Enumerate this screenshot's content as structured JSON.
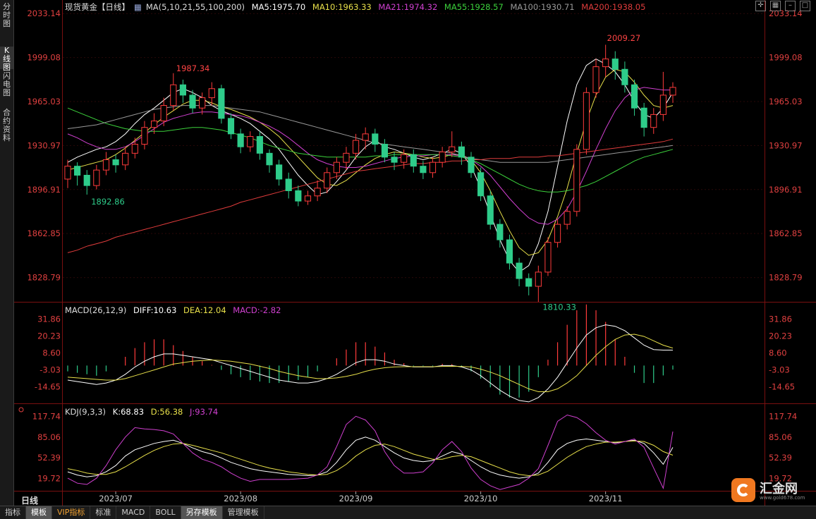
{
  "sidebar": {
    "items": [
      {
        "label": "分时图",
        "active": false
      },
      {
        "label": "K线图",
        "active": true
      },
      {
        "label": "闪电图",
        "active": false
      },
      {
        "label": "合约资料",
        "active": false
      }
    ]
  },
  "main_legend": {
    "title": "现货黄金【日线】",
    "ma_params": "MA(5,10,21,55,100,200)",
    "ma5": "MA5:1975.70",
    "ma10": "MA10:1963.33",
    "ma21": "MA21:1974.32",
    "ma55": "MA55:1928.57",
    "ma100": "MA100:1930.71",
    "ma200": "MA200:1938.05"
  },
  "macd_legend": {
    "params": "MACD(26,12,9)",
    "diff": "DIFF:10.63",
    "dea": "DEA:12.04",
    "macd": "MACD:-2.82"
  },
  "kdj_legend": {
    "params": "KDJ(9,3,3)",
    "k": "K:68.83",
    "d": "D:56.38",
    "j": "J:93.74"
  },
  "price_axis": [
    "2033.14",
    "1999.08",
    "1965.03",
    "1930.97",
    "1896.91",
    "1862.85",
    "1828.79"
  ],
  "macd_axis": [
    "31.86",
    "20.23",
    "8.60",
    "-3.03",
    "-14.65"
  ],
  "kdj_axis": [
    "117.74",
    "85.06",
    "52.39",
    "19.72"
  ],
  "date_axis": [
    "2023/07",
    "2023/08",
    "2023/09",
    "2023/10",
    "2023/11"
  ],
  "annotations": {
    "high1": "1987.34",
    "low1": "1892.86",
    "low2": "1810.33",
    "high2": "2009.27"
  },
  "period_label": "日线",
  "bottom_tabs": [
    {
      "label": "指标",
      "active": false
    },
    {
      "label": "模板",
      "active": true
    },
    {
      "label": "VIP指标",
      "active": false,
      "vip": true
    },
    {
      "label": "标准",
      "active": false
    },
    {
      "label": "MACD",
      "active": false
    },
    {
      "label": "BOLL",
      "active": false
    },
    {
      "label": "另存模板",
      "active": true
    },
    {
      "label": "管理模板",
      "active": false
    }
  ],
  "logo": {
    "text": "汇金网",
    "url": "www.gold678.com"
  },
  "colors": {
    "up": "#ff3b3b",
    "down": "#2ecc8a",
    "ma5": "#ffffff",
    "ma10": "#e8e04a",
    "ma21": "#d040d0",
    "ma55": "#3cd23c",
    "ma100": "#999999",
    "ma200": "#e03c3c",
    "axis_text": "#e04040"
  },
  "chart_data": {
    "type": "candlestick",
    "ylim": [
      1810,
      2036
    ],
    "ma": {
      "ma5": [
        1918,
        1922,
        1925,
        1928,
        1930,
        1934,
        1940,
        1948,
        1955,
        1960,
        1966,
        1972,
        1975,
        1972,
        1968,
        1962,
        1958,
        1955,
        1952,
        1948,
        1942,
        1936,
        1928,
        1918,
        1908,
        1900,
        1893,
        1895,
        1903,
        1912,
        1922,
        1930,
        1935,
        1930,
        1928,
        1925,
        1922,
        1920,
        1922,
        1925,
        1928,
        1925,
        1915,
        1898,
        1878,
        1858,
        1842,
        1833,
        1838,
        1855,
        1880,
        1915,
        1950,
        1978,
        1993,
        1998,
        1994,
        1988,
        1978,
        1965,
        1955,
        1952,
        1960,
        1972
      ],
      "ma10": [
        1912,
        1914,
        1916,
        1918,
        1920,
        1924,
        1929,
        1935,
        1941,
        1947,
        1953,
        1958,
        1963,
        1966,
        1966,
        1964,
        1961,
        1959,
        1956,
        1953,
        1949,
        1944,
        1938,
        1930,
        1922,
        1914,
        1906,
        1901,
        1900,
        1904,
        1910,
        1916,
        1921,
        1924,
        1926,
        1925,
        1924,
        1922,
        1921,
        1922,
        1924,
        1924,
        1920,
        1910,
        1896,
        1880,
        1865,
        1852,
        1846,
        1848,
        1858,
        1876,
        1898,
        1925,
        1950,
        1970,
        1984,
        1990,
        1988,
        1980,
        1970,
        1962,
        1960,
        1962
      ],
      "ma21": [
        1940,
        1937,
        1933,
        1930,
        1928,
        1928,
        1930,
        1934,
        1939,
        1944,
        1949,
        1952,
        1954,
        1956,
        1957,
        1957,
        1956,
        1955,
        1954,
        1952,
        1949,
        1946,
        1942,
        1937,
        1931,
        1925,
        1920,
        1917,
        1915,
        1914,
        1914,
        1915,
        1917,
        1919,
        1921,
        1922,
        1923,
        1923,
        1924,
        1924,
        1924,
        1923,
        1920,
        1915,
        1908,
        1899,
        1890,
        1882,
        1875,
        1871,
        1870,
        1874,
        1882,
        1895,
        1911,
        1928,
        1944,
        1958,
        1968,
        1974,
        1976,
        1975,
        1974,
        1974
      ],
      "ma55": [
        1960,
        1957,
        1954,
        1951,
        1948,
        1946,
        1944,
        1943,
        1942,
        1942,
        1942,
        1943,
        1944,
        1945,
        1945,
        1944,
        1943,
        1941,
        1939,
        1937,
        1934,
        1931,
        1929,
        1927,
        1925,
        1924,
        1923,
        1922,
        1922,
        1922,
        1922,
        1922,
        1923,
        1923,
        1924,
        1924,
        1924,
        1924,
        1924,
        1924,
        1923,
        1922,
        1920,
        1917,
        1913,
        1909,
        1905,
        1901,
        1898,
        1896,
        1895,
        1895,
        1896,
        1898,
        1900,
        1903,
        1907,
        1911,
        1915,
        1919,
        1922,
        1924,
        1926,
        1928
      ],
      "ma100": [
        1944,
        1945,
        1946,
        1947,
        1949,
        1951,
        1953,
        1955,
        1957,
        1959,
        1960,
        1961,
        1962,
        1962,
        1962,
        1962,
        1961,
        1960,
        1959,
        1958,
        1957,
        1955,
        1953,
        1951,
        1949,
        1947,
        1945,
        1943,
        1941,
        1939,
        1937,
        1935,
        1933,
        1932,
        1931,
        1930,
        1929,
        1928,
        1927,
        1926,
        1925,
        1923,
        1921,
        1920,
        1919,
        1918,
        1918,
        1918,
        1918,
        1918,
        1918,
        1919,
        1920,
        1921,
        1922,
        1923,
        1924,
        1925,
        1926,
        1927,
        1928,
        1929,
        1930,
        1931
      ],
      "ma200": [
        1848,
        1850,
        1853,
        1855,
        1857,
        1860,
        1862,
        1864,
        1866,
        1868,
        1870,
        1872,
        1874,
        1876,
        1878,
        1880,
        1882,
        1884,
        1887,
        1889,
        1891,
        1893,
        1895,
        1897,
        1899,
        1901,
        1903,
        1905,
        1907,
        1909,
        1911,
        1912,
        1913,
        1914,
        1915,
        1916,
        1917,
        1917,
        1918,
        1918,
        1919,
        1919,
        1920,
        1920,
        1921,
        1921,
        1921,
        1922,
        1922,
        1922,
        1923,
        1923,
        1924,
        1925,
        1926,
        1927,
        1928,
        1929,
        1930,
        1931,
        1932,
        1933,
        1934,
        1936
      ]
    },
    "candles": [
      [
        1905,
        1915,
        1898,
        1920
      ],
      [
        1915,
        1908,
        1900,
        1918
      ],
      [
        1908,
        1900,
        1893,
        1912
      ],
      [
        1900,
        1912,
        1897,
        1916
      ],
      [
        1912,
        1920,
        1908,
        1926
      ],
      [
        1920,
        1916,
        1910,
        1924
      ],
      [
        1916,
        1925,
        1912,
        1930
      ],
      [
        1925,
        1932,
        1921,
        1937
      ],
      [
        1932,
        1945,
        1928,
        1950
      ],
      [
        1945,
        1950,
        1940,
        1956
      ],
      [
        1950,
        1962,
        1946,
        1968
      ],
      [
        1962,
        1978,
        1958,
        1987
      ],
      [
        1978,
        1970,
        1964,
        1982
      ],
      [
        1970,
        1960,
        1956,
        1974
      ],
      [
        1960,
        1968,
        1955,
        1972
      ],
      [
        1968,
        1975,
        1962,
        1980
      ],
      [
        1975,
        1952,
        1948,
        1978
      ],
      [
        1952,
        1940,
        1936,
        1956
      ],
      [
        1940,
        1930,
        1925,
        1944
      ],
      [
        1930,
        1938,
        1926,
        1942
      ],
      [
        1938,
        1925,
        1920,
        1942
      ],
      [
        1925,
        1916,
        1910,
        1928
      ],
      [
        1916,
        1905,
        1900,
        1920
      ],
      [
        1905,
        1896,
        1890,
        1910
      ],
      [
        1896,
        1888,
        1884,
        1900
      ],
      [
        1888,
        1892,
        1885,
        1896
      ],
      [
        1892,
        1898,
        1888,
        1904
      ],
      [
        1898,
        1910,
        1894,
        1914
      ],
      [
        1910,
        1918,
        1905,
        1922
      ],
      [
        1918,
        1925,
        1912,
        1930
      ],
      [
        1925,
        1935,
        1920,
        1940
      ],
      [
        1935,
        1940,
        1928,
        1945
      ],
      [
        1940,
        1932,
        1926,
        1944
      ],
      [
        1932,
        1922,
        1918,
        1936
      ],
      [
        1922,
        1918,
        1912,
        1926
      ],
      [
        1918,
        1924,
        1913,
        1928
      ],
      [
        1924,
        1915,
        1910,
        1928
      ],
      [
        1915,
        1910,
        1905,
        1919
      ],
      [
        1910,
        1918,
        1906,
        1922
      ],
      [
        1918,
        1926,
        1914,
        1930
      ],
      [
        1926,
        1930,
        1922,
        1942
      ],
      [
        1930,
        1922,
        1916,
        1934
      ],
      [
        1922,
        1910,
        1906,
        1926
      ],
      [
        1910,
        1892,
        1888,
        1914
      ],
      [
        1892,
        1870,
        1866,
        1896
      ],
      [
        1870,
        1858,
        1852,
        1874
      ],
      [
        1858,
        1840,
        1835,
        1862
      ],
      [
        1840,
        1828,
        1822,
        1844
      ],
      [
        1828,
        1822,
        1815,
        1832
      ],
      [
        1822,
        1833,
        1810,
        1838
      ],
      [
        1833,
        1856,
        1830,
        1860
      ],
      [
        1856,
        1870,
        1852,
        1874
      ],
      [
        1870,
        1880,
        1866,
        1884
      ],
      [
        1880,
        1928,
        1876,
        1932
      ],
      [
        1928,
        1972,
        1924,
        1976
      ],
      [
        1972,
        1992,
        1968,
        1998
      ],
      [
        1992,
        1998,
        1984,
        2009
      ],
      [
        1998,
        1990,
        1982,
        2004
      ],
      [
        1990,
        1978,
        1972,
        1996
      ],
      [
        1978,
        1960,
        1954,
        1982
      ],
      [
        1960,
        1945,
        1938,
        1964
      ],
      [
        1945,
        1955,
        1940,
        1960
      ],
      [
        1955,
        1970,
        1950,
        1988
      ],
      [
        1970,
        1976,
        1964,
        1980
      ]
    ],
    "macd": {
      "diff": [
        -10,
        -11,
        -12,
        -13,
        -12,
        -10,
        -6,
        -1,
        3,
        6,
        8,
        8,
        7,
        6,
        5,
        4,
        2,
        0,
        -2,
        -4,
        -6,
        -8,
        -10,
        -11,
        -12,
        -12,
        -11,
        -9,
        -6,
        -2,
        2,
        4,
        4,
        3,
        1,
        0,
        -1,
        -1,
        -1,
        0,
        0,
        -1,
        -3,
        -7,
        -12,
        -17,
        -21,
        -24,
        -25,
        -22,
        -16,
        -8,
        2,
        12,
        21,
        26,
        28,
        27,
        24,
        19,
        14,
        11,
        10.6,
        10.6
      ],
      "dea": [
        -8,
        -8.5,
        -9,
        -9.5,
        -10,
        -10,
        -9,
        -7,
        -5,
        -3,
        -1,
        1,
        2,
        3,
        3.5,
        3.8,
        3.5,
        3,
        2,
        1,
        -0.5,
        -2,
        -4,
        -5.5,
        -7,
        -8,
        -9,
        -9,
        -8.5,
        -7.5,
        -6,
        -4,
        -2.5,
        -1.5,
        -1,
        -0.8,
        -0.8,
        -0.8,
        -0.8,
        -0.6,
        -0.5,
        -0.6,
        -1,
        -2.5,
        -4.5,
        -7,
        -10,
        -13,
        -16,
        -18,
        -18,
        -16,
        -12,
        -7,
        0,
        7,
        13,
        18,
        21,
        21.5,
        20,
        17,
        14,
        12
      ]
    },
    "kdj": {
      "k": [
        30,
        25,
        22,
        24,
        30,
        40,
        55,
        65,
        70,
        75,
        78,
        80,
        75,
        68,
        62,
        58,
        52,
        45,
        40,
        35,
        32,
        30,
        28,
        26,
        25,
        24,
        25,
        30,
        45,
        65,
        80,
        85,
        80,
        70,
        60,
        52,
        48,
        46,
        48,
        55,
        62,
        58,
        48,
        38,
        30,
        25,
        22,
        20,
        22,
        28,
        45,
        65,
        75,
        80,
        82,
        80,
        78,
        76,
        78,
        80,
        75,
        60,
        42,
        68.8
      ],
      "d": [
        35,
        32,
        28,
        26,
        26,
        30,
        38,
        47,
        56,
        64,
        70,
        74,
        75,
        72,
        68,
        64,
        60,
        55,
        50,
        45,
        40,
        36,
        33,
        30,
        28,
        26,
        25,
        26,
        32,
        42,
        55,
        65,
        72,
        74,
        70,
        64,
        58,
        54,
        50,
        50,
        54,
        56,
        54,
        48,
        42,
        36,
        30,
        26,
        24,
        25,
        31,
        42,
        53,
        62,
        70,
        74,
        77,
        77,
        78,
        79,
        78,
        72,
        62,
        56.4
      ],
      "j": [
        20,
        12,
        10,
        20,
        40,
        65,
        85,
        100,
        98,
        97,
        95,
        90,
        75,
        60,
        50,
        45,
        38,
        28,
        20,
        15,
        18,
        18,
        18,
        18,
        19,
        20,
        25,
        38,
        70,
        105,
        118,
        112,
        95,
        62,
        40,
        28,
        28,
        30,
        44,
        65,
        78,
        62,
        36,
        18,
        8,
        2,
        6,
        10,
        20,
        35,
        72,
        110,
        120,
        116,
        106,
        92,
        80,
        74,
        78,
        82,
        69,
        36,
        4,
        93.7
      ]
    }
  }
}
